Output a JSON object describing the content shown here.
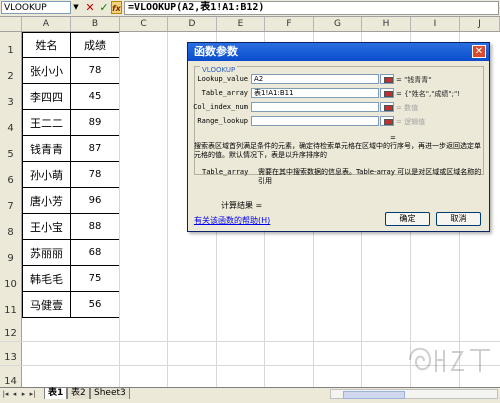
{
  "formula_bar": {
    "name_box": "VLOOKUP",
    "name_box_dropdown": "▼",
    "cancel_icon": "✕",
    "enter_icon": "✓",
    "insert_function_icon": "fx",
    "formula": "=VLOOKUP(A2,表1!A1:B12)"
  },
  "columns": [
    "A",
    "B",
    "C",
    "D",
    "E",
    "F",
    "G",
    "H",
    "I",
    "J"
  ],
  "rows": [
    {
      "num": "1",
      "a": "姓名",
      "b": "成绩"
    },
    {
      "num": "2",
      "a": "张小小",
      "b": "78"
    },
    {
      "num": "3",
      "a": "李四四",
      "b": "45"
    },
    {
      "num": "4",
      "a": "王二二",
      "b": "89"
    },
    {
      "num": "5",
      "a": "钱青青",
      "b": "87"
    },
    {
      "num": "6",
      "a": "孙小萌",
      "b": "78"
    },
    {
      "num": "7",
      "a": "唐小芳",
      "b": "96"
    },
    {
      "num": "8",
      "a": "王小宝",
      "b": "88"
    },
    {
      "num": "9",
      "a": "苏丽丽",
      "b": "68"
    },
    {
      "num": "10",
      "a": "韩毛毛",
      "b": "75"
    },
    {
      "num": "11",
      "a": "马健壹",
      "b": "56"
    },
    {
      "num": "12",
      "a": "",
      "b": ""
    },
    {
      "num": "13",
      "a": "",
      "b": ""
    },
    {
      "num": "14",
      "a": "",
      "b": ""
    }
  ],
  "dialog": {
    "title": "函数参数",
    "close": "✕",
    "group_label": "VLOOKUP",
    "args": [
      {
        "label": "Lookup_value",
        "value": "A2",
        "result": "= \"钱青青\"",
        "gray": false
      },
      {
        "label": "Table_array",
        "value": "表1!A1:B11",
        "result": "= {\"姓名\",\"成绩\";\"!",
        "gray": false
      },
      {
        "label": "Col_index_num",
        "value": "",
        "result": "= 数值",
        "gray": true
      },
      {
        "label": "Range_lookup",
        "value": "",
        "result": "= 逻辑值",
        "gray": true
      }
    ],
    "equals": "=",
    "description": "搜索表区域首列满足条件的元素，确定待检索单元格在区域中的行序号，再进一步返回选定单元格的值。默认情况下，表是以升序排序的",
    "param_name": "Table_array",
    "param_desc": "需要在其中搜索数据的信息表。Table-array 可以是对区域或区域名称的引用",
    "result_label": "计算结果 =",
    "help_link": "有关该函数的帮助(H)",
    "ok": "确定",
    "cancel": "取消"
  },
  "sheet_tabs": {
    "nav": [
      "|◂",
      "◂",
      "▸",
      "▸|"
    ],
    "tabs": [
      "表1",
      "表2",
      "Sheet3"
    ],
    "active": 0
  },
  "colors": {
    "accent": "#0a4ccc",
    "selected_header": "#f9d99a"
  }
}
